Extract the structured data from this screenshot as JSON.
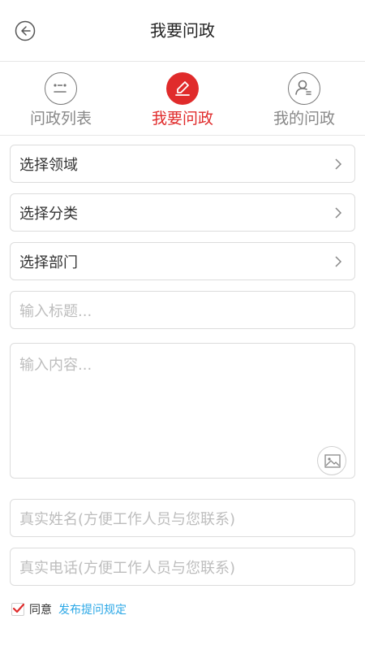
{
  "header": {
    "title": "我要问政"
  },
  "tabs": [
    {
      "label": "问政列表",
      "icon": "face-list-icon"
    },
    {
      "label": "我要问政",
      "icon": "pencil-icon"
    },
    {
      "label": "我的问政",
      "icon": "user-icon"
    }
  ],
  "selects": {
    "domain": "选择领域",
    "category": "选择分类",
    "department": "选择部门"
  },
  "inputs": {
    "title_placeholder": "输入标题...",
    "content_placeholder": "输入内容...",
    "name_placeholder": "真实姓名(方便工作人员与您联系)",
    "phone_placeholder": "真实电话(方便工作人员与您联系)"
  },
  "agreement": {
    "checked": true,
    "agree_text": "同意",
    "link_text": "发布提问规定"
  },
  "colors": {
    "accent": "#e02b2b",
    "link": "#2aa7e6"
  }
}
